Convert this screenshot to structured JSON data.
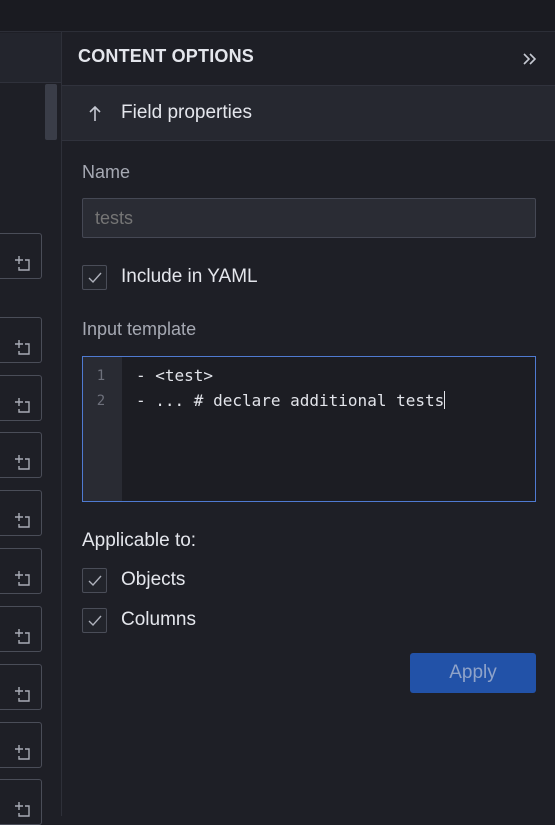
{
  "panel": {
    "title": "CONTENT OPTIONS",
    "collapse_icon": "double-chevron-right-icon"
  },
  "section": {
    "icon": "arrow-up-icon",
    "label": "Field properties"
  },
  "name_field": {
    "label": "Name",
    "placeholder": "tests",
    "value": ""
  },
  "include_yaml": {
    "label": "Include in YAML",
    "checked": true
  },
  "input_template": {
    "label": "Input template",
    "lines": [
      {
        "number": "1",
        "text": "- <test>"
      },
      {
        "number": "2",
        "text": "- ... # declare additional tests"
      }
    ]
  },
  "applicable": {
    "heading": "Applicable to:",
    "options": [
      {
        "label": "Objects",
        "checked": true
      },
      {
        "label": "Columns",
        "checked": true
      }
    ]
  },
  "apply_label": "Apply",
  "left_column": {
    "button_icon": "add-to-corner-icon",
    "button_count": 10
  },
  "colors": {
    "accent": "#2252a8",
    "editor_border": "#4f7ad1",
    "background": "#1e1f26"
  }
}
